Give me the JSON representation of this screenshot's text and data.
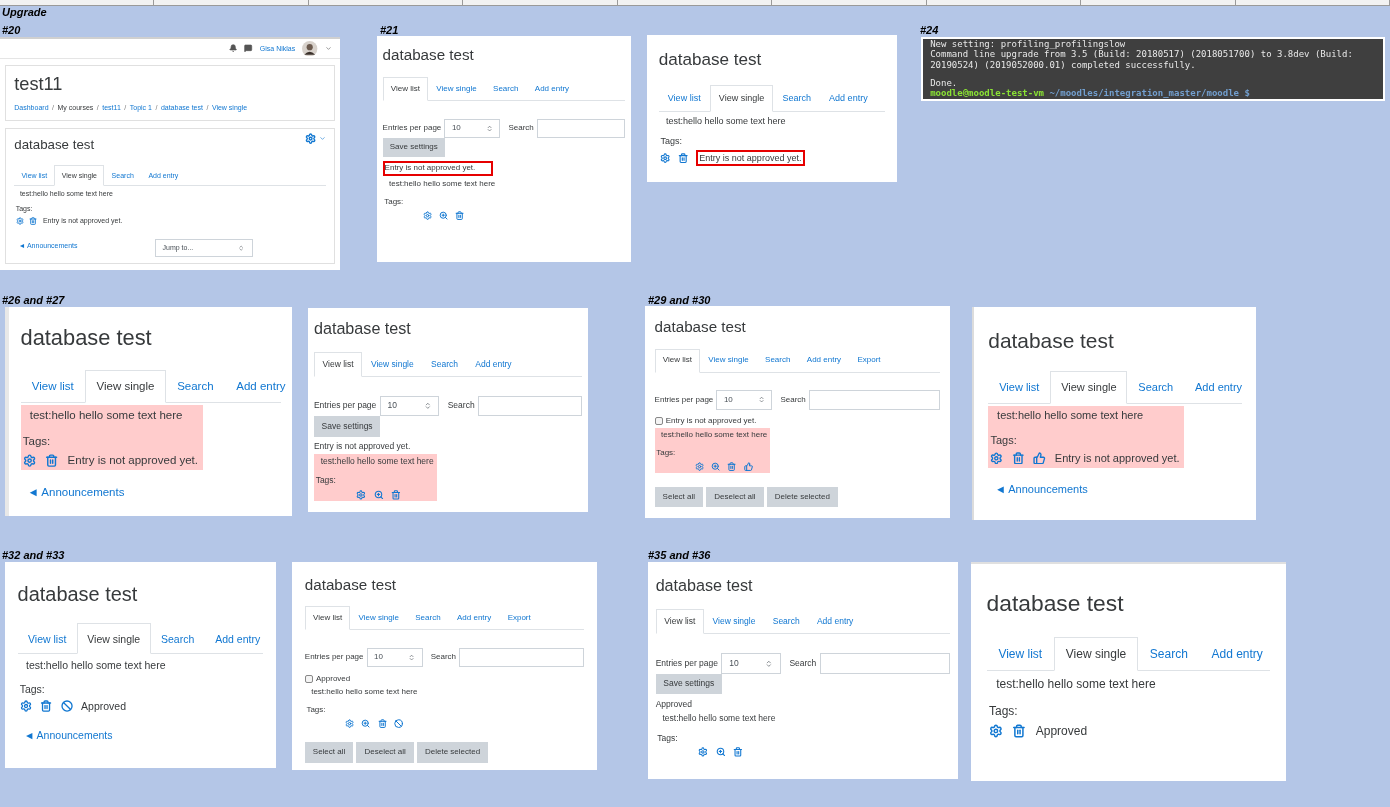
{
  "captions": [
    "Upgrade",
    "#20",
    "#21",
    "#24",
    "#26 and #27",
    "#29 and #30",
    "#32 and #33",
    "#35 and #36"
  ],
  "panels": [
    {
      "kind": "moodle",
      "blocks": [
        {
          "kind": "topbar",
          "user": "Gisa Niklas"
        },
        {
          "kind": "course",
          "title": "test11",
          "separator": "/",
          "crumbs": [
            {
              "label": "Dashboard",
              "link": true
            },
            {
              "label": "My courses",
              "link": false
            },
            {
              "label": "test11",
              "link": true
            },
            {
              "label": "Topic 1",
              "link": true
            },
            {
              "label": "database test",
              "link": true
            },
            {
              "label": "View single",
              "link": true
            }
          ]
        },
        {
          "kind": "card",
          "blocks": [
            {
              "kind": "heading",
              "title": "database test",
              "settings_menu": true
            },
            {
              "kind": "tabs",
              "tabs": [
                {
                  "label": "View list",
                  "selected": false
                },
                {
                  "label": "View single",
                  "selected": true
                },
                {
                  "label": "Search",
                  "selected": false
                },
                {
                  "label": "Add entry",
                  "selected": false
                }
              ]
            },
            {
              "kind": "entry",
              "text": "test:hello hello some text here",
              "tags": "Tags:",
              "actions": [
                {
                  "kind": "edit"
                },
                {
                  "kind": "delete"
                }
              ],
              "status": "Entry is not approved yet.",
              "highlighted": false,
              "status_outlined": false
            },
            {
              "kind": "nav",
              "link": "◄ Announcements",
              "jump": "Jump to..."
            }
          ]
        }
      ]
    },
    {
      "kind": "moodle",
      "blocks": [
        {
          "kind": "heading",
          "title": "database test"
        },
        {
          "kind": "tabs",
          "tabs": [
            {
              "label": "View list",
              "selected": true
            },
            {
              "label": "View single",
              "selected": false
            },
            {
              "label": "Search",
              "selected": false
            },
            {
              "label": "Add entry",
              "selected": false
            }
          ]
        },
        {
          "kind": "controls",
          "label": "Entries per page",
          "value": "10",
          "search": "Search",
          "save": "Save settings"
        },
        {
          "kind": "note",
          "text": "Entry is not approved yet.",
          "outlined": true
        },
        {
          "kind": "entry",
          "text": "test:hello hello some text here",
          "tags": "Tags:",
          "actions": [
            {
              "kind": "edit"
            },
            {
              "kind": "more"
            },
            {
              "kind": "delete"
            }
          ],
          "highlighted": false
        }
      ]
    },
    {
      "kind": "moodle",
      "blocks": [
        {
          "kind": "heading",
          "title": "database test"
        },
        {
          "kind": "tabs",
          "tabs": [
            {
              "label": "View list",
              "selected": false
            },
            {
              "label": "View single",
              "selected": true
            },
            {
              "label": "Search",
              "selected": false
            },
            {
              "label": "Add entry",
              "selected": false
            }
          ]
        },
        {
          "kind": "entry",
          "text": "test:hello hello some text here",
          "tags": "Tags:",
          "actions": [
            {
              "kind": "edit"
            },
            {
              "kind": "delete"
            }
          ],
          "status": "Entry is not approved yet.",
          "highlighted": false,
          "status_outlined": true
        }
      ]
    },
    {
      "kind": "terminal",
      "output": [
        "New setting: profiling_profilingslow",
        "Command line upgrade from 3.5 (Build: 20180517) (2018051700) to 3.8dev (Build:",
        "20190524) (2019052000.01) completed successfully."
      ],
      "result": "Done.",
      "prompt_user": "moodle@moodle-test-vm",
      "prompt_path": "~/moodles/integration_master/moodle $"
    },
    {
      "kind": "moodle",
      "blocks": [
        {
          "kind": "heading",
          "title": "database test"
        },
        {
          "kind": "tabs",
          "tabs": [
            {
              "label": "View list",
              "selected": false
            },
            {
              "label": "View single",
              "selected": true
            },
            {
              "label": "Search",
              "selected": false
            },
            {
              "label": "Add entry",
              "selected": false
            }
          ]
        },
        {
          "kind": "entry",
          "text": "test:hello hello some text here",
          "tags": "Tags:",
          "actions": [
            {
              "kind": "edit"
            },
            {
              "kind": "delete"
            }
          ],
          "status": "Entry is not approved yet.",
          "highlighted": true,
          "status_outlined": false
        },
        {
          "kind": "nav",
          "link": "◄ Announcements"
        }
      ]
    },
    {
      "kind": "moodle",
      "blocks": [
        {
          "kind": "heading",
          "title": "database test"
        },
        {
          "kind": "tabs",
          "tabs": [
            {
              "label": "View list",
              "selected": true
            },
            {
              "label": "View single",
              "selected": false
            },
            {
              "label": "Search",
              "selected": false
            },
            {
              "label": "Add entry",
              "selected": false
            }
          ]
        },
        {
          "kind": "controls",
          "label": "Entries per page",
          "value": "10",
          "search": "Search",
          "save": "Save settings"
        },
        {
          "kind": "note",
          "text": "Entry is not approved yet.",
          "outlined": false
        },
        {
          "kind": "entry",
          "text": "test:hello hello some text here",
          "tags": "Tags:",
          "actions": [
            {
              "kind": "edit"
            },
            {
              "kind": "more"
            },
            {
              "kind": "delete"
            }
          ],
          "highlighted": true
        }
      ]
    },
    {
      "kind": "moodle",
      "blocks": [
        {
          "kind": "heading",
          "title": "database test"
        },
        {
          "kind": "tabs",
          "tabs": [
            {
              "label": "View list",
              "selected": true
            },
            {
              "label": "View single",
              "selected": false
            },
            {
              "label": "Search",
              "selected": false
            },
            {
              "label": "Add entry",
              "selected": false
            },
            {
              "label": "Export",
              "selected": false
            }
          ]
        },
        {
          "kind": "controls",
          "label": "Entries per page",
          "value": "10",
          "search": "Search"
        },
        {
          "kind": "note",
          "text": "Entry is not approved yet.",
          "outlined": false,
          "checked": false
        },
        {
          "kind": "entry",
          "text": "test:hello hello some text here",
          "tags": "Tags:",
          "actions": [
            {
              "kind": "edit"
            },
            {
              "kind": "more"
            },
            {
              "kind": "delete"
            },
            {
              "kind": "approve"
            }
          ],
          "highlighted": true
        },
        {
          "kind": "buttons",
          "buttons": [
            "Select all",
            "Deselect all",
            "Delete selected"
          ]
        }
      ]
    },
    {
      "kind": "moodle",
      "blocks": [
        {
          "kind": "heading",
          "title": "database test"
        },
        {
          "kind": "tabs",
          "tabs": [
            {
              "label": "View list",
              "selected": false
            },
            {
              "label": "View single",
              "selected": true
            },
            {
              "label": "Search",
              "selected": false
            },
            {
              "label": "Add entry",
              "selected": false
            }
          ]
        },
        {
          "kind": "entry",
          "text": "test:hello hello some text here",
          "tags": "Tags:",
          "actions": [
            {
              "kind": "edit"
            },
            {
              "kind": "delete"
            },
            {
              "kind": "approve"
            }
          ],
          "status": "Entry is not approved yet.",
          "highlighted": true,
          "status_outlined": false
        },
        {
          "kind": "nav",
          "link": "◄ Announcements"
        }
      ]
    },
    {
      "kind": "moodle",
      "blocks": [
        {
          "kind": "heading",
          "title": "database test"
        },
        {
          "kind": "tabs",
          "tabs": [
            {
              "label": "View list",
              "selected": false
            },
            {
              "label": "View single",
              "selected": true
            },
            {
              "label": "Search",
              "selected": false
            },
            {
              "label": "Add entry",
              "selected": false
            }
          ]
        },
        {
          "kind": "entry",
          "text": "test:hello hello some text here",
          "tags": "Tags:",
          "actions": [
            {
              "kind": "edit"
            },
            {
              "kind": "delete"
            },
            {
              "kind": "disapprove"
            }
          ],
          "status": "Approved",
          "highlighted": false,
          "status_outlined": false
        },
        {
          "kind": "nav",
          "link": "◄ Announcements"
        }
      ]
    },
    {
      "kind": "moodle",
      "blocks": [
        {
          "kind": "heading",
          "title": "database test"
        },
        {
          "kind": "tabs",
          "tabs": [
            {
              "label": "View list",
              "selected": true
            },
            {
              "label": "View single",
              "selected": false
            },
            {
              "label": "Search",
              "selected": false
            },
            {
              "label": "Add entry",
              "selected": false
            },
            {
              "label": "Export",
              "selected": false
            }
          ]
        },
        {
          "kind": "controls",
          "label": "Entries per page",
          "value": "10",
          "search": "Search"
        },
        {
          "kind": "note",
          "text": "Approved",
          "outlined": false,
          "checked": false
        },
        {
          "kind": "entry",
          "text": "test:hello hello some text here",
          "tags": "Tags:",
          "actions": [
            {
              "kind": "edit"
            },
            {
              "kind": "more"
            },
            {
              "kind": "delete"
            },
            {
              "kind": "disapprove"
            }
          ],
          "highlighted": false
        },
        {
          "kind": "buttons",
          "buttons": [
            "Select all",
            "Deselect all",
            "Delete selected"
          ]
        }
      ]
    },
    {
      "kind": "moodle",
      "blocks": [
        {
          "kind": "heading",
          "title": "database test"
        },
        {
          "kind": "tabs",
          "tabs": [
            {
              "label": "View list",
              "selected": true
            },
            {
              "label": "View single",
              "selected": false
            },
            {
              "label": "Search",
              "selected": false
            },
            {
              "label": "Add entry",
              "selected": false
            }
          ]
        },
        {
          "kind": "controls",
          "label": "Entries per page",
          "value": "10",
          "search": "Search",
          "save": "Save settings"
        },
        {
          "kind": "note",
          "text": "Approved",
          "outlined": false
        },
        {
          "kind": "entry",
          "text": "test:hello hello some text here",
          "tags": "Tags:",
          "actions": [
            {
              "kind": "edit"
            },
            {
              "kind": "more"
            },
            {
              "kind": "delete"
            }
          ],
          "highlighted": false
        }
      ]
    },
    {
      "kind": "moodle",
      "blocks": [
        {
          "kind": "heading",
          "title": "database test"
        },
        {
          "kind": "tabs",
          "tabs": [
            {
              "label": "View list",
              "selected": false
            },
            {
              "label": "View single",
              "selected": true
            },
            {
              "label": "Search",
              "selected": false
            },
            {
              "label": "Add entry",
              "selected": false
            }
          ]
        },
        {
          "kind": "entry",
          "text": "test:hello hello some text here",
          "tags": "Tags:",
          "actions": [
            {
              "kind": "edit"
            },
            {
              "kind": "delete"
            }
          ],
          "status": "Approved",
          "highlighted": false,
          "status_outlined": false
        }
      ]
    }
  ]
}
